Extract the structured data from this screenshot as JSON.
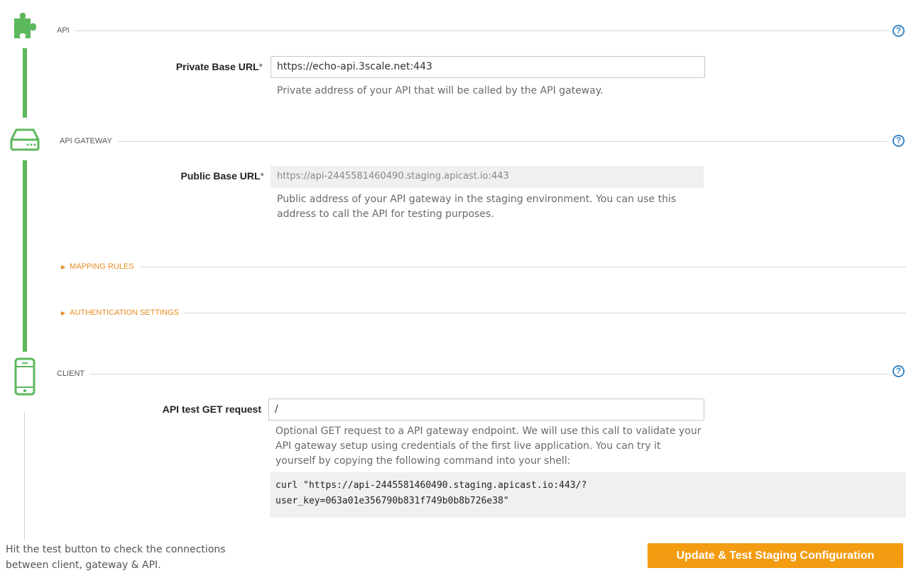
{
  "colors": {
    "timeline_green": "#5cb85c",
    "accent_orange": "#f39c12",
    "help_blue": "#3a86c4"
  },
  "api": {
    "title": "API",
    "icon": "puzzle-icon",
    "private_base_url_label": "Private Base URL",
    "required_mark": "*",
    "private_base_url_value": "https://echo-api.3scale.net:443",
    "private_base_url_hint": "Private address of your API that will be called by the API gateway."
  },
  "gateway": {
    "title": "API GATEWAY",
    "icon": "server-icon",
    "public_base_url_label": "Public Base URL",
    "required_mark": "*",
    "public_base_url_value": "https://api-2445581460490.staging.apicast.io:443",
    "public_base_url_hint": "Public address of your API gateway in the staging environment. You can use this address to call the API for testing purposes.",
    "mapping_rules_label": "MAPPING RULES",
    "authentication_settings_label": "AUTHENTICATION SETTINGS"
  },
  "client": {
    "title": "CLIENT",
    "icon": "mobile-phone-icon",
    "test_request_label": "API test GET request",
    "test_request_value": "/",
    "test_request_hint": "Optional GET request to a API gateway endpoint. We will use this call to validate your API gateway setup using credentials of the first live application. You can try it yourself by copying the following command into your shell:",
    "curl_line_1": "curl \"https://api-2445581460490.staging.apicast.io:443/?",
    "curl_line_2": "user_key=063a01e356790b831f749b0b8b726e38\""
  },
  "help_label": "?",
  "footer": {
    "hint": "Hit the test button to check the connections between client, gateway & API.",
    "button_label": "Update & Test Staging Configuration"
  }
}
